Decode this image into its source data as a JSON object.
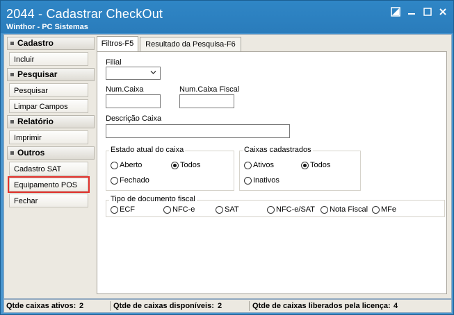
{
  "window": {
    "title": "2044 - Cadastrar CheckOut",
    "subtitle": "Winthor - PC Sistemas"
  },
  "sidebar": {
    "groups": [
      {
        "header": "Cadastro",
        "items": [
          "Incluir"
        ]
      },
      {
        "header": "Pesquisar",
        "items": [
          "Pesquisar",
          "Limpar Campos"
        ]
      },
      {
        "header": "Relatório",
        "items": [
          "Imprimir"
        ]
      },
      {
        "header": "Outros",
        "items": [
          "Cadastro SAT",
          "Equipamento POS",
          "Fechar"
        ]
      }
    ]
  },
  "tabs": [
    "Filtros-F5",
    "Resultado da Pesquisa-F6"
  ],
  "form": {
    "filial_label": "Filial",
    "filial_value": "",
    "num_caixa_label": "Num.Caixa",
    "num_caixa_value": "",
    "num_caixa_fiscal_label": "Num.Caixa Fiscal",
    "num_caixa_fiscal_value": "",
    "descricao_label": "Descrição Caixa",
    "descricao_value": "",
    "estado": {
      "legend": "Estado atual do caixa",
      "options": [
        "Aberto",
        "Todos",
        "Fechado"
      ],
      "selected": "Todos"
    },
    "cadastrados": {
      "legend": "Caixas cadastrados",
      "options": [
        "Ativos",
        "Todos",
        "Inativos"
      ],
      "selected": "Todos"
    },
    "tipo_doc": {
      "legend": "Tipo de documento fiscal",
      "options": [
        "ECF",
        "NFC-e",
        "SAT",
        "NFC-e/SAT",
        "Nota Fiscal",
        "MFe"
      ]
    }
  },
  "status": {
    "ativos_label": "Qtde caixas ativos:",
    "ativos_value": "2",
    "disponiveis_label": "Qtde de caixas disponíveis:",
    "disponiveis_value": "2",
    "liberados_label": "Qtde de caixas liberados pela licença:",
    "liberados_value": "4"
  }
}
